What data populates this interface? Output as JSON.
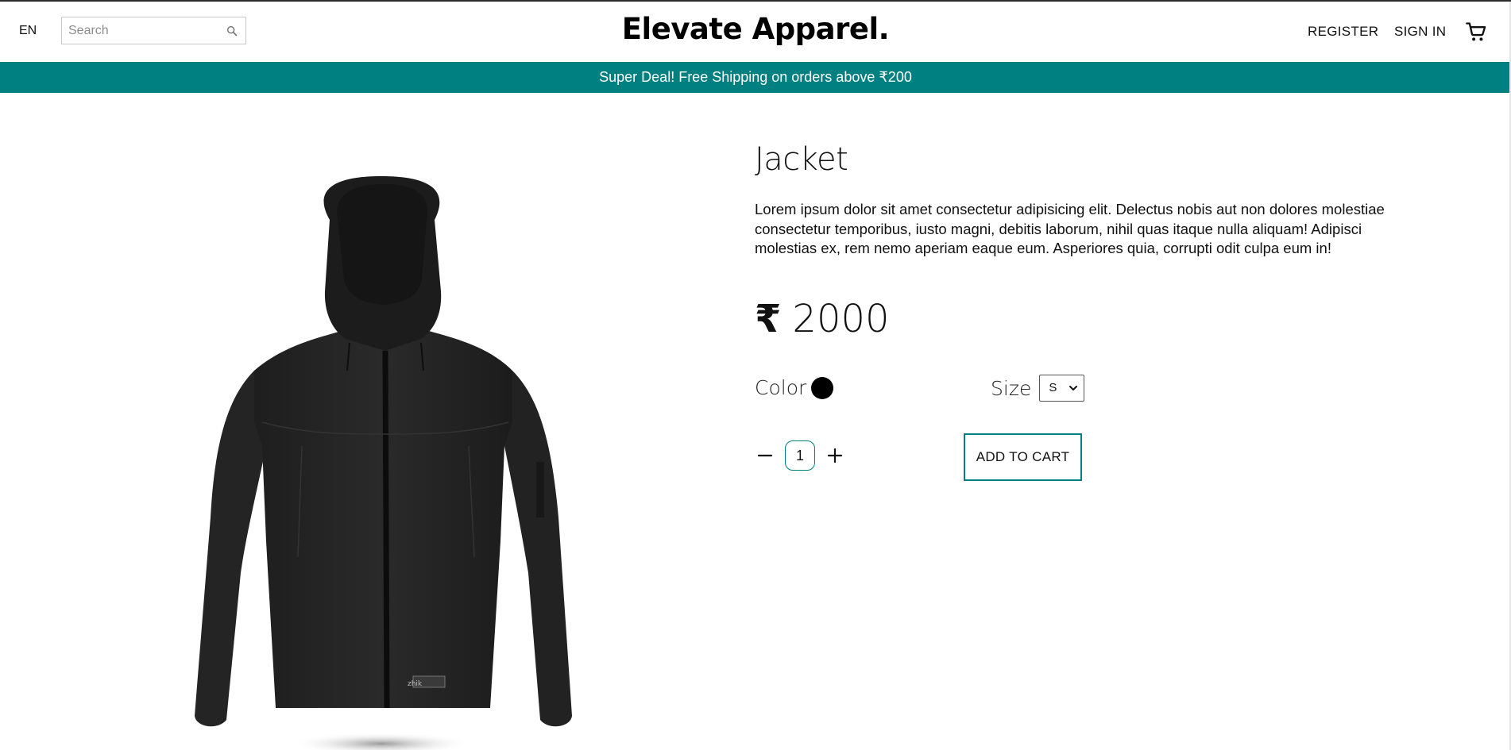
{
  "navbar": {
    "language": "EN",
    "search": {
      "placeholder": "Search",
      "value": ""
    },
    "logo": "Elevate Apparel.",
    "register": "REGISTER",
    "sign_in": "SIGN IN",
    "icons": {
      "search": "search-icon",
      "cart": "cart-icon"
    }
  },
  "announcement": "Super Deal! Free Shipping on orders above ₹200",
  "product": {
    "title": "Jacket",
    "description": "Lorem ipsum dolor sit amet consectetur adipisicing elit. Delectus nobis aut non dolores molestiae consectetur temporibus, iusto magni, debitis laborum, nihil quas itaque nulla aliquam! Adipisci molestias ex, rem nemo aperiam eaque eum. Asperiores quia, corrupti odit culpa eum in!",
    "currency": "₹",
    "price": "2000",
    "color_label": "Color",
    "colors": [
      "#000000"
    ],
    "size_label": "Size",
    "size_selected": "S",
    "quantity": "1",
    "add_to_cart": "ADD TO CART"
  },
  "colors": {
    "accent": "#008080",
    "text": "#111111",
    "background": "#ffffff"
  }
}
